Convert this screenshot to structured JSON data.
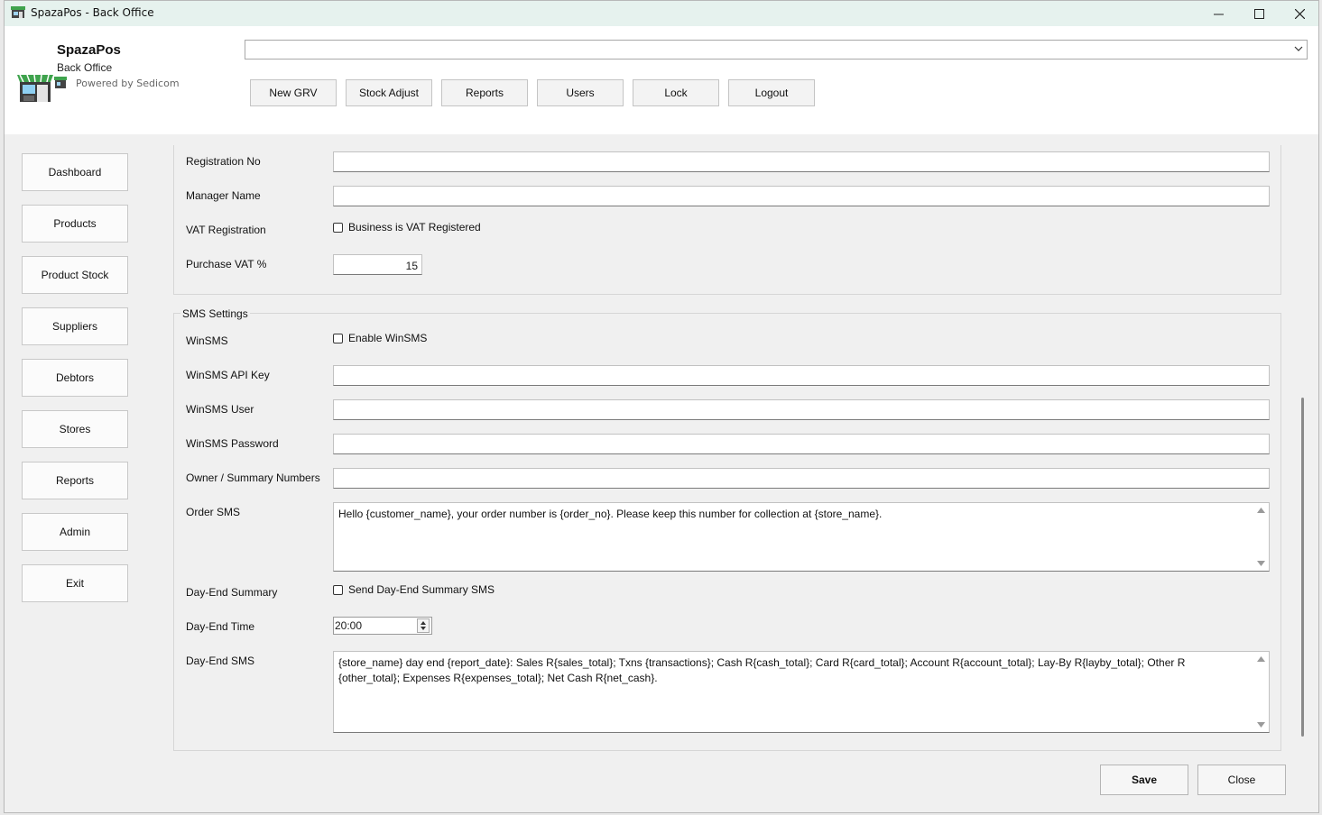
{
  "window": {
    "title": "SpazaPos - Back Office",
    "controls": {
      "minimize": "minimize-icon",
      "maximize": "maximize-icon",
      "close": "close-icon"
    }
  },
  "header": {
    "brand": "SpazaPos",
    "subtitle": "Back Office",
    "powered_by": "Powered by Sedicom",
    "store_selector_value": "",
    "buttons": [
      "New GRV",
      "Stock Adjust",
      "Reports",
      "Users",
      "Lock",
      "Logout"
    ]
  },
  "sidebar": {
    "items": [
      {
        "label": "Dashboard"
      },
      {
        "label": "Products"
      },
      {
        "label": "Product Stock"
      },
      {
        "label": "Suppliers"
      },
      {
        "label": "Debtors"
      },
      {
        "label": "Stores"
      },
      {
        "label": "Reports"
      },
      {
        "label": "Admin"
      },
      {
        "label": "Exit"
      }
    ]
  },
  "business": {
    "registration_no_label": "Registration No",
    "registration_no_value": "",
    "manager_name_label": "Manager Name",
    "manager_name_value": "",
    "vat_registration_label": "VAT Registration",
    "vat_registered_checkbox_label": "Business is VAT Registered",
    "vat_registered_checked": false,
    "purchase_vat_label": "Purchase VAT %",
    "purchase_vat_value": "15"
  },
  "sms": {
    "group_title": "SMS Settings",
    "winsms_label": "WinSMS",
    "enable_winsms_label": "Enable WinSMS",
    "enable_winsms_checked": false,
    "api_key_label": "WinSMS API Key",
    "api_key_value": "",
    "user_label": "WinSMS User",
    "user_value": "",
    "password_label": "WinSMS Password",
    "password_value": "",
    "owner_numbers_label": "Owner / Summary Numbers",
    "owner_numbers_value": "",
    "order_sms_label": "Order SMS",
    "order_sms_value": "Hello {customer_name}, your order number is {order_no}. Please keep this number for collection at {store_name}.",
    "day_end_summary_label": "Day-End Summary",
    "send_day_end_label": "Send Day-End Summary SMS",
    "send_day_end_checked": false,
    "day_end_time_label": "Day-End Time",
    "day_end_time_value": "20:00",
    "day_end_sms_label": "Day-End SMS",
    "day_end_sms_value": "{store_name} day end {report_date}: Sales R{sales_total}; Txns {transactions}; Cash R{cash_total}; Card R{card_total}; Account R{account_total}; Lay-By R{layby_total}; Other R\n{other_total}; Expenses R{expenses_total}; Net Cash R{net_cash}."
  },
  "footer": {
    "save_label": "Save",
    "close_label": "Close"
  },
  "colors": {
    "titlebar": "#e6f2ee",
    "window": "#f0f0f0",
    "logo_green": "#3fa34d"
  }
}
